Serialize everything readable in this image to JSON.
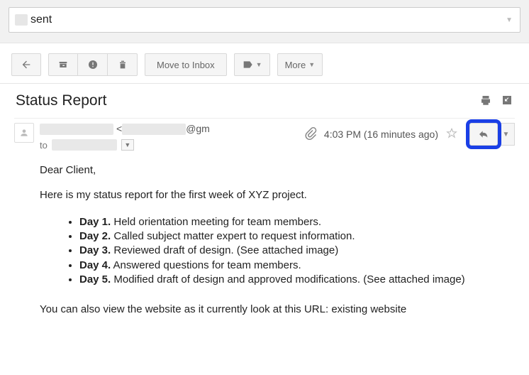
{
  "search": {
    "query": "sent"
  },
  "toolbar": {
    "move_to_inbox": "Move to Inbox",
    "more": "More"
  },
  "subject": "Status Report",
  "sender": {
    "email_suffix": "@gm",
    "to_label": "to"
  },
  "meta": {
    "time": "4:03 PM (16 minutes ago)"
  },
  "body": {
    "greeting": "Dear Client,",
    "intro": "Here is my status report for the first week of XYZ project.",
    "days": [
      {
        "label": "Day 1.",
        "text": " Held orientation meeting for team members."
      },
      {
        "label": "Day 2.",
        "text": " Called subject matter expert to request information."
      },
      {
        "label": "Day 3.",
        "text": " Reviewed draft of design. (See attached image)"
      },
      {
        "label": "Day 4.",
        "text": " Answered questions for team members."
      },
      {
        "label": "Day 5.",
        "text": " Modified draft of design and approved modifications. (See attached image)"
      }
    ],
    "closing": "You can also view the website as it currently look at this URL: existing website"
  }
}
